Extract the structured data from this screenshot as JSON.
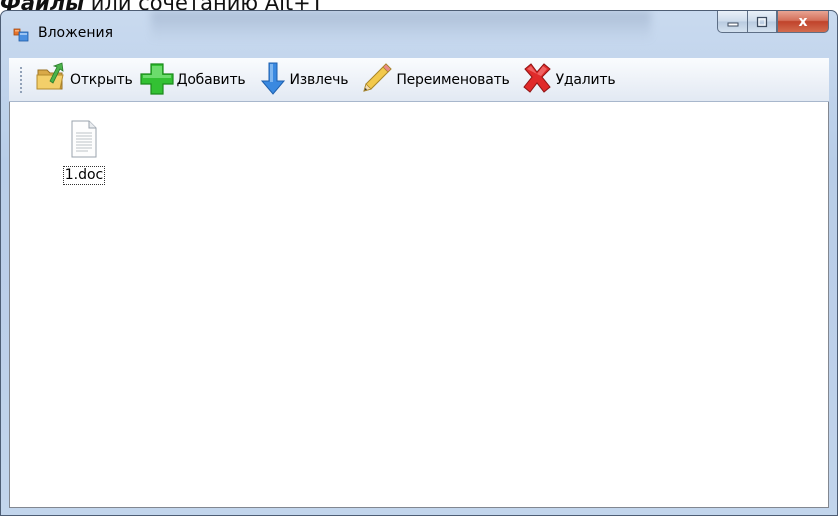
{
  "doc_caption": {
    "bold_part": "Файлы",
    "rest": " или сочетанию Alt+Т"
  },
  "window": {
    "title": "Вложения",
    "buttons": {
      "close": "x"
    }
  },
  "toolbar": {
    "items": [
      {
        "label": "Открыть",
        "icon": "open-folder-icon"
      },
      {
        "label": "Добавить",
        "icon": "add-plus-icon"
      },
      {
        "label": "Извлечь",
        "icon": "extract-arrow-down-icon"
      },
      {
        "label": "Переименовать",
        "icon": "rename-pencil-icon"
      },
      {
        "label": "Удалить",
        "icon": "delete-x-icon"
      }
    ]
  },
  "files": [
    {
      "name": "1.doc",
      "icon": "document-file-icon"
    }
  ],
  "colors": {
    "title_bar": "#c2d5ec",
    "close_button": "#c0432b",
    "add_icon": "#2db52d",
    "delete_icon": "#d8242a",
    "extract_icon": "#2f7fd6"
  }
}
